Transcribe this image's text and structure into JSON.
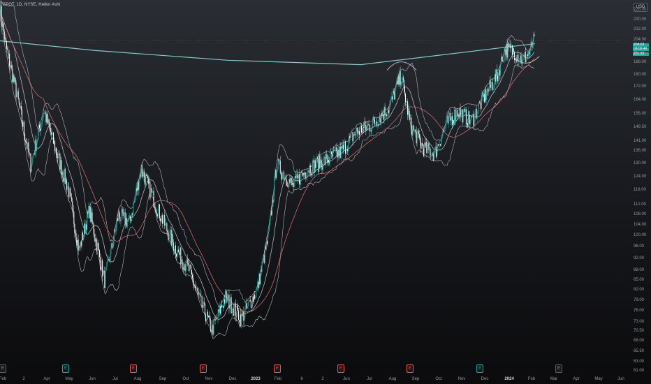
{
  "header": {
    "title": "SPOT, 1D, NYSE, Heikin Ashi"
  },
  "currency": "USD",
  "y_ticks": [
    "228.00",
    "220.00",
    "212.00",
    "204.00",
    "196.00",
    "188.00",
    "180.00",
    "172.00",
    "164.00",
    "156.00",
    "148.50",
    "141.00",
    "136.00",
    "130.00",
    "124.00",
    "118.00",
    "112.00",
    "108.00",
    "104.00",
    "100.00",
    "96.00",
    "92.00",
    "88.00",
    "85.00",
    "82.00",
    "79.00",
    "76.00",
    "73.00",
    "70.50",
    "68.00",
    "65.50",
    "63.00",
    "61.00"
  ],
  "x_ticks": [
    {
      "label": "Feb",
      "bold": false
    },
    {
      "label": "2",
      "bold": false
    },
    {
      "label": "Apr",
      "bold": false
    },
    {
      "label": "May",
      "bold": false
    },
    {
      "label": "Jun",
      "bold": false
    },
    {
      "label": "Jul",
      "bold": false
    },
    {
      "label": "Aug",
      "bold": false
    },
    {
      "label": "Sep",
      "bold": false
    },
    {
      "label": "Oct",
      "bold": false
    },
    {
      "label": "Nov",
      "bold": false
    },
    {
      "label": "Dec",
      "bold": false
    },
    {
      "label": "2023",
      "bold": true
    },
    {
      "label": "Feb",
      "bold": false
    },
    {
      "label": "6",
      "bold": false
    },
    {
      "label": "2",
      "bold": false
    },
    {
      "label": "Jun",
      "bold": false
    },
    {
      "label": "Jul",
      "bold": false
    },
    {
      "label": "Aug",
      "bold": false
    },
    {
      "label": "Sep",
      "bold": false
    },
    {
      "label": "Oct",
      "bold": false
    },
    {
      "label": "Nov",
      "bold": false
    },
    {
      "label": "Dec",
      "bold": false
    },
    {
      "label": "2024",
      "bold": true
    },
    {
      "label": "Feb",
      "bold": false
    },
    {
      "label": "Mar",
      "bold": false
    },
    {
      "label": "Apr",
      "bold": false
    },
    {
      "label": "May",
      "bold": false
    },
    {
      "label": "Jun",
      "bold": false
    }
  ],
  "price_tags": [
    {
      "label": "204.63",
      "color": "#26a69a",
      "text": "#ffffff"
    },
    {
      "label": "09:09:46",
      "color": "#26a69a",
      "text": "#ffffff"
    },
    {
      "label": "201.83",
      "color": "#26a69a",
      "text": "#ffffff"
    }
  ],
  "events": [
    {
      "type": "E",
      "kind": "e"
    },
    {
      "type": "E",
      "kind": "d"
    },
    {
      "type": "E",
      "kind": "s"
    },
    {
      "type": "E",
      "kind": "s"
    },
    {
      "type": "E",
      "kind": "s"
    },
    {
      "type": "E",
      "kind": "s"
    },
    {
      "type": "E",
      "kind": "s"
    },
    {
      "type": "E",
      "kind": "d"
    },
    {
      "type": "E",
      "kind": "e"
    }
  ],
  "colors": {
    "up": "#26a69a",
    "down": "#ffffff",
    "bands": "#b2b5be",
    "ma_slow": "#e57373",
    "ma_long": "#80cbc4"
  },
  "chart_data": {
    "type": "candlestick",
    "symbol": "SPOT",
    "interval": "1D",
    "exchange": "NYSE",
    "style": "Heikin Ashi",
    "ylim": [
      61,
      232
    ],
    "y_scale": "log",
    "x_start": "2022-01-24",
    "x_end": "2024-06-01",
    "last_price": 204.63,
    "countdown": "09:09:46",
    "ma_value": 201.83,
    "indicators": [
      "Bollinger Bands",
      "Moving Average",
      "Long Moving Average"
    ],
    "price_path": [
      [
        "2022-01-24",
        230
      ],
      [
        "2022-02-01",
        200
      ],
      [
        "2022-02-15",
        170
      ],
      [
        "2022-03-07",
        130
      ],
      [
        "2022-03-25",
        158
      ],
      [
        "2022-04-12",
        135
      ],
      [
        "2022-04-28",
        118
      ],
      [
        "2022-05-12",
        95
      ],
      [
        "2022-05-26",
        110
      ],
      [
        "2022-06-16",
        85
      ],
      [
        "2022-07-05",
        108
      ],
      [
        "2022-07-20",
        105
      ],
      [
        "2022-08-05",
        128
      ],
      [
        "2022-08-25",
        112
      ],
      [
        "2022-09-20",
        96
      ],
      [
        "2022-10-10",
        88
      ],
      [
        "2022-10-26",
        78
      ],
      [
        "2022-11-10",
        71
      ],
      [
        "2022-11-28",
        80
      ],
      [
        "2022-12-20",
        74
      ],
      [
        "2023-01-10",
        82
      ],
      [
        "2023-01-26",
        100
      ],
      [
        "2023-02-06",
        130
      ],
      [
        "2023-02-28",
        120
      ],
      [
        "2023-03-20",
        128
      ],
      [
        "2023-04-15",
        132
      ],
      [
        "2023-05-05",
        136
      ],
      [
        "2023-05-25",
        146
      ],
      [
        "2023-06-15",
        150
      ],
      [
        "2023-07-10",
        160
      ],
      [
        "2023-07-26",
        180
      ],
      [
        "2023-08-08",
        150
      ],
      [
        "2023-08-25",
        138
      ],
      [
        "2023-09-10",
        135
      ],
      [
        "2023-09-25",
        150
      ],
      [
        "2023-10-12",
        158
      ],
      [
        "2023-10-30",
        152
      ],
      [
        "2023-11-15",
        165
      ],
      [
        "2023-12-05",
        180
      ],
      [
        "2023-12-15",
        198
      ],
      [
        "2023-12-28",
        196
      ],
      [
        "2024-01-08",
        190
      ],
      [
        "2024-01-18",
        196
      ],
      [
        "2024-01-25",
        206
      ]
    ]
  }
}
